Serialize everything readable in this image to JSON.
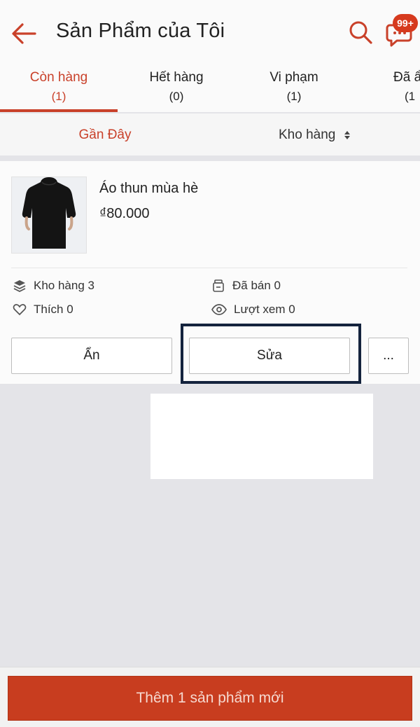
{
  "header": {
    "title": "Sản Phẩm của Tôi",
    "badge": "99+",
    "back_icon": "arrow-left-icon",
    "search_icon": "search-icon",
    "chat_icon": "chat-icon"
  },
  "tabs": [
    {
      "label": "Còn hàng",
      "count": "(1)",
      "active": true
    },
    {
      "label": "Hết hàng",
      "count": "(0)",
      "active": false
    },
    {
      "label": "Vi phạm",
      "count": "(1)",
      "active": false
    },
    {
      "label": "Đã ẩ",
      "count": "(1",
      "active": false
    }
  ],
  "sort": {
    "recent": "Gần Đây",
    "stock": "Kho hàng"
  },
  "product": {
    "name": "Áo thun mùa hè",
    "price": "₫80.000",
    "stats": {
      "stock": "Kho hàng 3",
      "sold": "Đã bán 0",
      "likes": "Thích 0",
      "views": "Lượt xem 0"
    },
    "actions": {
      "hide": "Ẩn",
      "edit": "Sửa",
      "more": "..."
    }
  },
  "footer": {
    "add_button": "Thêm 1 sản phẩm mới"
  },
  "colors": {
    "accent": "#c9412a",
    "primary_button": "#c83d1f",
    "highlight_frame": "#14233d"
  }
}
